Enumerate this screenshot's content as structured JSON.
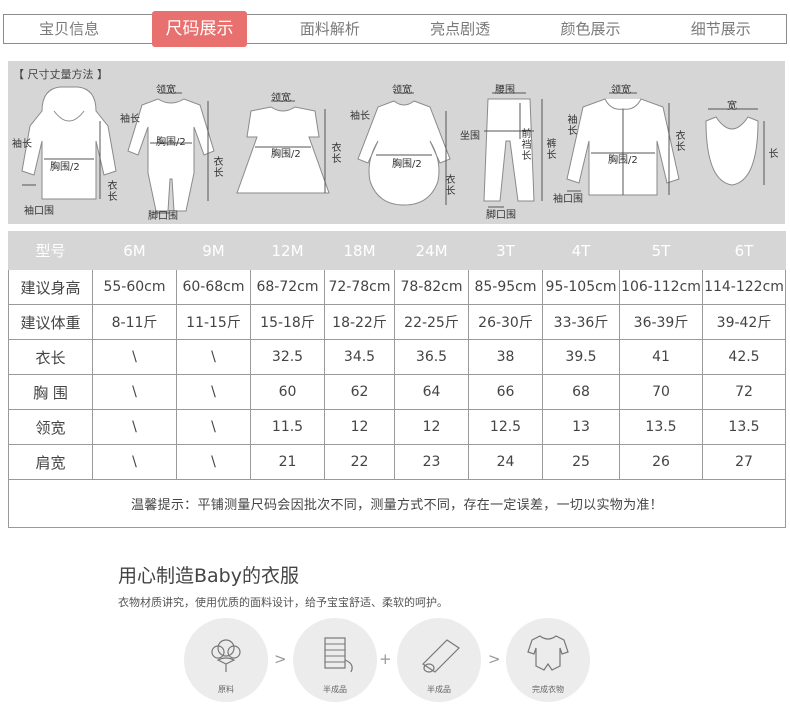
{
  "tabs": [
    {
      "label": "宝贝信息"
    },
    {
      "label": "尺码展示"
    },
    {
      "label": "面料解析"
    },
    {
      "label": "亮点剧透"
    },
    {
      "label": "颜色展示"
    },
    {
      "label": "细节展示"
    }
  ],
  "measure": {
    "title": "【 尺寸丈量方法 】",
    "figures": [
      {
        "labels": [
          "袖长",
          "胸围/2",
          "衣长",
          "袖口围"
        ]
      },
      {
        "labels": [
          "领宽",
          "袖长",
          "胸围/2",
          "衣长",
          "脚口围"
        ]
      },
      {
        "labels": [
          "领宽",
          "胸围/2",
          "衣长"
        ]
      },
      {
        "labels": [
          "领宽",
          "袖长",
          "胸围/2",
          "衣长"
        ]
      },
      {
        "labels": [
          "腰围",
          "坐围",
          "前裆长",
          "裤长",
          "脚口围"
        ]
      },
      {
        "labels": [
          "领宽",
          "袖长",
          "胸围/2",
          "衣长",
          "袖口围"
        ]
      },
      {
        "labels": [
          "宽",
          "长"
        ]
      }
    ]
  },
  "table": {
    "header": [
      "型号",
      "6M",
      "9M",
      "12M",
      "18M",
      "24M",
      "3T",
      "4T",
      "5T",
      "6T"
    ],
    "rows": [
      {
        "label": "建议身高",
        "cells": [
          "55-60cm",
          "60-68cm",
          "68-72cm",
          "72-78cm",
          "78-82cm",
          "85-95cm",
          "95-105cm",
          "106-112cm",
          "114-122cm"
        ]
      },
      {
        "label": "建议体重",
        "cells": [
          "8-11斤",
          "11-15斤",
          "15-18斤",
          "18-22斤",
          "22-25斤",
          "26-30斤",
          "33-36斤",
          "36-39斤",
          "39-42斤"
        ]
      },
      {
        "label": "衣长",
        "cells": [
          "\\",
          "\\",
          "32.5",
          "34.5",
          "36.5",
          "38",
          "39.5",
          "41",
          "42.5"
        ]
      },
      {
        "label": "胸 围",
        "cells": [
          "\\",
          "\\",
          "60",
          "62",
          "64",
          "66",
          "68",
          "70",
          "72"
        ]
      },
      {
        "label": "领宽",
        "cells": [
          "\\",
          "\\",
          "11.5",
          "12",
          "12",
          "12.5",
          "13",
          "13.5",
          "13.5"
        ]
      },
      {
        "label": "肩宽",
        "cells": [
          "\\",
          "\\",
          "21",
          "22",
          "23",
          "24",
          "25",
          "26",
          "27"
        ]
      }
    ],
    "note": "温馨提示：平铺测量尺码会因批次不同，测量方式不同，存在一定误差，一切以实物为准！"
  },
  "craft": {
    "title": "用心制造Baby的衣服",
    "desc": "衣物材质讲究，使用优质的面料设计，给予宝宝舒适、柔软的呵护。",
    "steps": [
      {
        "caption": "原料",
        "icon": "cotton-icon"
      },
      {
        "caption": "半成品",
        "icon": "yarn-spool-icon"
      },
      {
        "caption": "半成品",
        "icon": "fabric-roll-icon"
      },
      {
        "caption": "完成衣物",
        "icon": "romper-icon"
      }
    ],
    "connectors": [
      ">",
      "+",
      ">"
    ]
  }
}
